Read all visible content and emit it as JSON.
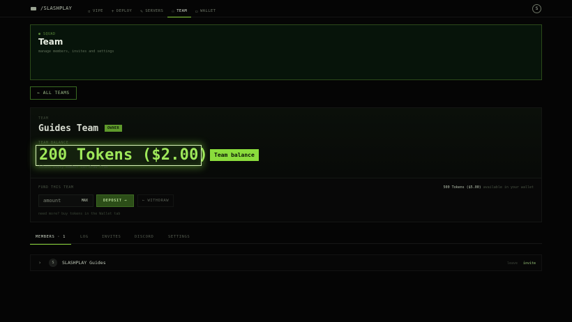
{
  "nav": {
    "brand": "/SLASHPLAY",
    "items": [
      {
        "label": "VIPE",
        "icon": "box-icon"
      },
      {
        "label": "DEPLOY",
        "icon": "plus-icon"
      },
      {
        "label": "SERVERS",
        "icon": "tools-icon"
      },
      {
        "label": "TEAM",
        "icon": "users-icon"
      },
      {
        "label": "WALLET",
        "icon": "wallet-icon"
      }
    ],
    "active": "TEAM",
    "profile_initial": "S"
  },
  "header": {
    "eyebrow": "● SQUAD",
    "title": "Team",
    "subtitle": "manage members, invites and settings"
  },
  "back_button": "← ALL TEAMS",
  "team": {
    "label": "TEAM",
    "name": "Guides Team",
    "role_badge": "OWNER",
    "balance_label": "TEAM BALANCE",
    "balance_value": "200 Tokens ($2.00)",
    "balance_tag": "Team balance",
    "balance_note": "tokens every member can draw from"
  },
  "fund": {
    "label": "FUND THIS TEAM",
    "wallet_amount": "500 Tokens ($5.00)",
    "wallet_suffix": "available in your wallet",
    "amount_placeholder": "amount",
    "max_label": "MAX",
    "deposit_label": "DEPOSIT →",
    "withdraw_label": "← WITHDRAW",
    "note": "need more? buy tokens in the Wallet tab"
  },
  "tabs": [
    "MEMBERS · 1",
    "LOG",
    "INVITES",
    "DISCORD",
    "SETTINGS"
  ],
  "active_tab": 0,
  "members": [
    {
      "initial": "S",
      "name": "SLASHPLAY Guides",
      "leave_label": "leave",
      "invite_label": "invite"
    }
  ],
  "colors": {
    "accent": "#8adc3c",
    "background": "#050505",
    "panel_border": "#2c4a1a"
  }
}
